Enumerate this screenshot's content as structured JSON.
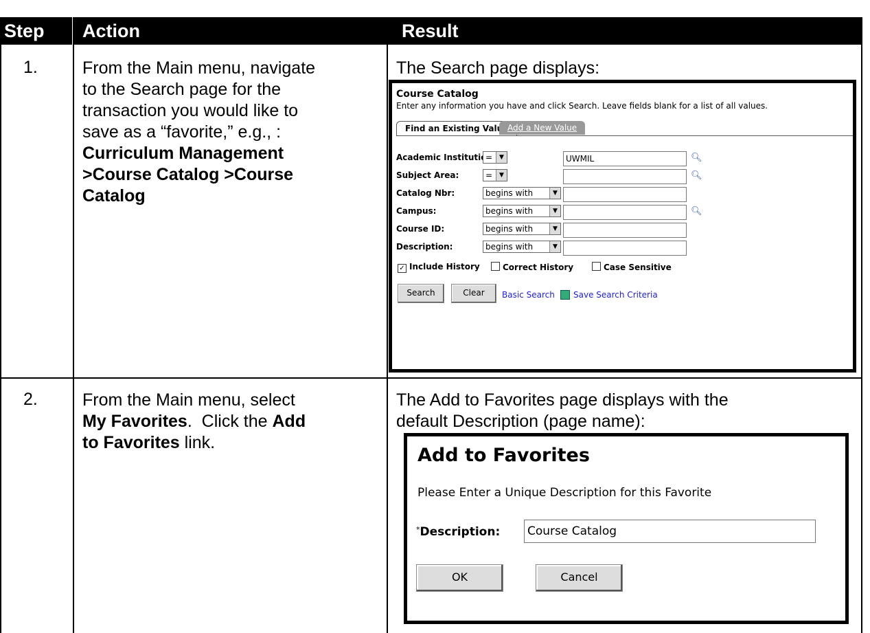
{
  "table": {
    "headers": {
      "step": "Step",
      "action": "Action",
      "result": "Result"
    },
    "rows": [
      {
        "step": "1.",
        "action_lines": [
          "From the Main menu, navigate",
          "to the Search page for the",
          "transaction you would like to",
          "save as a “favorite,” e.g., :"
        ],
        "action_bold_lines": [
          "Curriculum Management",
          ">Course Catalog >Course",
          "Catalog"
        ],
        "result": "The Search page displays:"
      },
      {
        "step": "2.",
        "action_line1_a": "From the Main menu, select",
        "action_line2_bold": "My Favorites",
        "action_line2_rest": ".  Click the ",
        "action_line2_bold2": "Add",
        "action_line3_bold": "to Favorites",
        "action_line3_rest": " link.",
        "result_lines": [
          "The Add to Favorites page displays with the",
          "default Description (page name):"
        ]
      }
    ]
  },
  "search_panel": {
    "title": "Course Catalog",
    "instructions": "Enter any information you have and click Search. Leave fields blank for a list of all values.",
    "tab_active": "Find an Existing Value",
    "tab_inactive": "Add a New Value",
    "fields": [
      {
        "label": "Academic Institution:",
        "op": "=",
        "value": "UWMIL",
        "lookup": true
      },
      {
        "label": "Subject Area:",
        "op": "=",
        "value": "",
        "lookup": true
      },
      {
        "label": "Catalog Nbr:",
        "op": "begins with",
        "value": "",
        "lookup": false
      },
      {
        "label": "Campus:",
        "op": "begins with",
        "value": "",
        "lookup": true
      },
      {
        "label": "Course ID:",
        "op": "begins with",
        "value": "",
        "lookup": false
      },
      {
        "label": "Description:",
        "op": "begins with",
        "value": "",
        "lookup": false
      }
    ],
    "checkboxes": [
      {
        "label": "Include History",
        "checked": true
      },
      {
        "label": "Correct History",
        "checked": false
      },
      {
        "label": "Case Sensitive",
        "checked": false
      }
    ],
    "buttons": {
      "search": "Search",
      "clear": "Clear"
    },
    "links": {
      "basic_search": "Basic Search",
      "save_criteria": "Save Search Criteria"
    }
  },
  "favorites_panel": {
    "title": "Add to Favorites",
    "message": "Please Enter a Unique Description for this Favorite",
    "required_mark": "*",
    "label": "Description:",
    "value": "Course Catalog",
    "ok": "OK",
    "cancel": "Cancel"
  },
  "icons": {
    "lookup": "magnifier-icon",
    "dropdown": "chevron-down-icon",
    "save": "floppy-icon",
    "check": "checkmark-icon"
  }
}
